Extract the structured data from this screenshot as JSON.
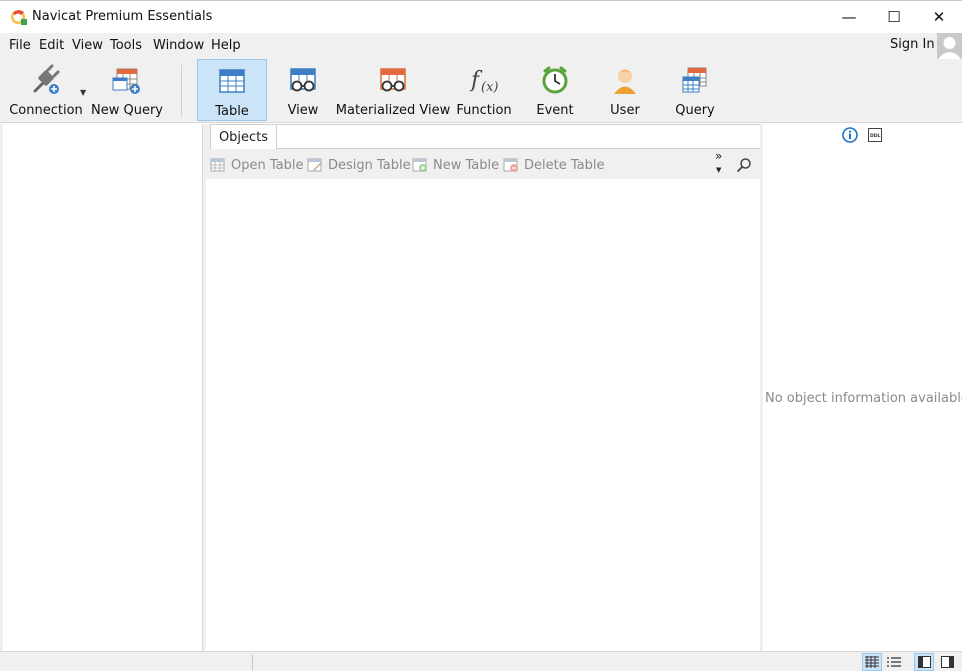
{
  "window": {
    "title": "Navicat Premium Essentials",
    "minimize_glyph": "—",
    "maximize_glyph": "☐",
    "close_glyph": "✕"
  },
  "menu": {
    "items": [
      "File",
      "Edit",
      "View",
      "Tools",
      "Window",
      "Help"
    ],
    "sign_in": "Sign In"
  },
  "toolbar": {
    "connection": "Connection",
    "new_query": "New Query",
    "table": "Table",
    "view": "View",
    "materialized_view": "Materialized View",
    "function": "Function",
    "event": "Event",
    "user": "User",
    "query": "Query",
    "active": "Table"
  },
  "tabs": {
    "objects": "Objects"
  },
  "object_toolbar": {
    "open_table": "Open Table",
    "design_table": "Design Table",
    "new_table": "New Table",
    "delete_table": "Delete Table",
    "more_glyph": "»"
  },
  "info_panel": {
    "empty_message": "No object information available."
  },
  "colors": {
    "accent_active": "#cce4f7",
    "accent_border": "#9cc8ec",
    "table_blue": "#3d7ec4",
    "query_orange": "#e06b3f",
    "event_green": "#5aa33c",
    "user_orange": "#f0a030",
    "info_blue": "#1a73c7"
  }
}
